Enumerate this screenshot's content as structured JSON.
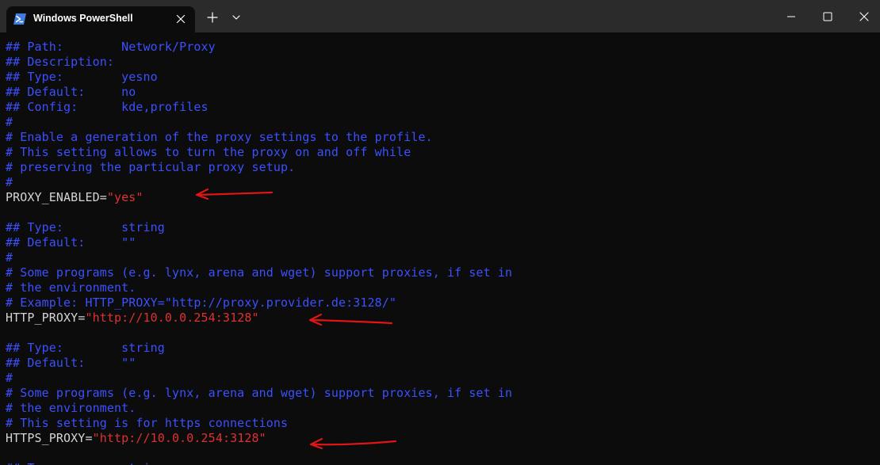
{
  "window": {
    "tab_title": "Windows PowerShell"
  },
  "colors": {
    "comment": "#3b50ff",
    "variable": "#d4d4d4",
    "string": "#e03131",
    "annotation": "#e01515"
  },
  "icons": {
    "tab": "powershell-icon",
    "close_tab": "close-icon",
    "new_tab": "plus-icon",
    "dropdown": "chevron-down-icon",
    "minimize": "minimize-icon",
    "maximize": "maximize-icon",
    "close_window": "close-icon"
  },
  "terminal": {
    "lines": [
      {
        "type": "comment",
        "text": "## Path:        Network/Proxy"
      },
      {
        "type": "comment",
        "text": "## Description:"
      },
      {
        "type": "comment",
        "text": "## Type:        yesno"
      },
      {
        "type": "comment",
        "text": "## Default:     no"
      },
      {
        "type": "comment",
        "text": "## Config:      kde,profiles"
      },
      {
        "type": "comment",
        "text": "#"
      },
      {
        "type": "comment",
        "text": "# Enable a generation of the proxy settings to the profile."
      },
      {
        "type": "comment",
        "text": "# This setting allows to turn the proxy on and off while"
      },
      {
        "type": "comment",
        "text": "# preserving the particular proxy setup."
      },
      {
        "type": "comment",
        "text": "#"
      },
      {
        "type": "assign",
        "name": "PROXY_ENABLED",
        "op": "=",
        "value": "\"yes\""
      },
      {
        "type": "blank",
        "text": ""
      },
      {
        "type": "comment",
        "text": "## Type:        string"
      },
      {
        "type": "comment",
        "text": "## Default:     \"\""
      },
      {
        "type": "comment",
        "text": "#"
      },
      {
        "type": "comment",
        "text": "# Some programs (e.g. lynx, arena and wget) support proxies, if set in"
      },
      {
        "type": "comment",
        "text": "# the environment."
      },
      {
        "type": "comment",
        "text": "# Example: HTTP_PROXY=\"http://proxy.provider.de:3128/\""
      },
      {
        "type": "assign",
        "name": "HTTP_PROXY",
        "op": "=",
        "value": "\"http://10.0.0.254:3128\""
      },
      {
        "type": "blank",
        "text": ""
      },
      {
        "type": "comment",
        "text": "## Type:        string"
      },
      {
        "type": "comment",
        "text": "## Default:     \"\""
      },
      {
        "type": "comment",
        "text": "#"
      },
      {
        "type": "comment",
        "text": "# Some programs (e.g. lynx, arena and wget) support proxies, if set in"
      },
      {
        "type": "comment",
        "text": "# the environment."
      },
      {
        "type": "comment",
        "text": "# This setting is for https connections"
      },
      {
        "type": "assign",
        "name": "HTTPS_PROXY",
        "op": "=",
        "value": "\"http://10.0.0.254:3128\""
      },
      {
        "type": "blank",
        "text": ""
      },
      {
        "type": "comment",
        "text": "## Type:        string"
      }
    ]
  }
}
